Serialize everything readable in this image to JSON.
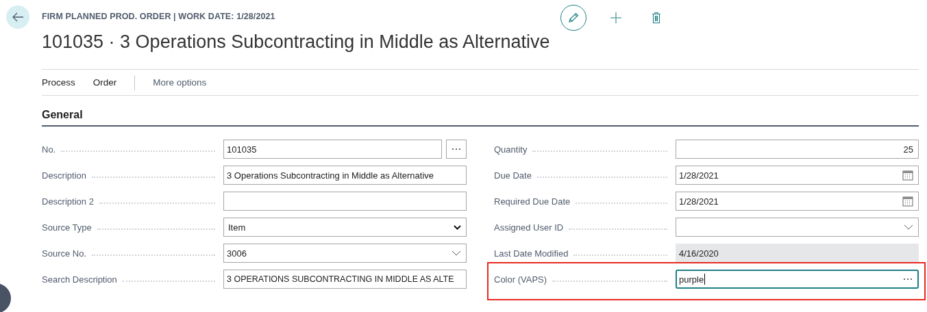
{
  "header": {
    "breadcrumb": "FIRM PLANNED PROD. ORDER | WORK DATE: 1/28/2021",
    "title": "101035 · 3 Operations Subcontracting in Middle as Alternative"
  },
  "actions": [
    {
      "label": "Process",
      "kind": "menu"
    },
    {
      "label": "Order",
      "kind": "menu"
    },
    {
      "label": "More options",
      "kind": "more"
    }
  ],
  "section": {
    "title": "General"
  },
  "columns": [
    [
      {
        "label": "No.",
        "value": "101035",
        "kind": "lookup",
        "focused": false,
        "highlighted": false
      },
      {
        "label": "Description",
        "value": "3 Operations Subcontracting in Middle as Alternative",
        "kind": "text",
        "focused": false,
        "highlighted": false
      },
      {
        "label": "Description 2",
        "kind": "text",
        "focused": false,
        "highlighted": false
      },
      {
        "label": "Source Type",
        "value": "Item",
        "kind": "select",
        "focused": false,
        "highlighted": false
      },
      {
        "label": "Source No.",
        "value": "3006",
        "kind": "dropdown",
        "focused": false,
        "highlighted": false
      },
      {
        "label": "Search Description",
        "value": "3 OPERATIONS SUBCONTRACTING IN MIDDLE AS ALTE",
        "kind": "text",
        "focused": false,
        "highlighted": false
      }
    ],
    [
      {
        "label": "Quantity",
        "value": "25",
        "kind": "number",
        "focused": false,
        "highlighted": false
      },
      {
        "label": "Due Date",
        "value": "1/28/2021",
        "kind": "date",
        "focused": false,
        "highlighted": false
      },
      {
        "label": "Required Due Date",
        "value": "1/28/2021",
        "kind": "date",
        "focused": false,
        "highlighted": false
      },
      {
        "label": "Assigned User ID",
        "kind": "dropdown",
        "focused": false,
        "highlighted": false
      },
      {
        "label": "Last Date Modified",
        "value": "4/16/2020",
        "kind": "readonly",
        "focused": false,
        "highlighted": false
      },
      {
        "label": "Color (VAPS)",
        "value": "purple",
        "kind": "assist",
        "focused": true,
        "highlighted": true
      }
    ]
  ]
}
